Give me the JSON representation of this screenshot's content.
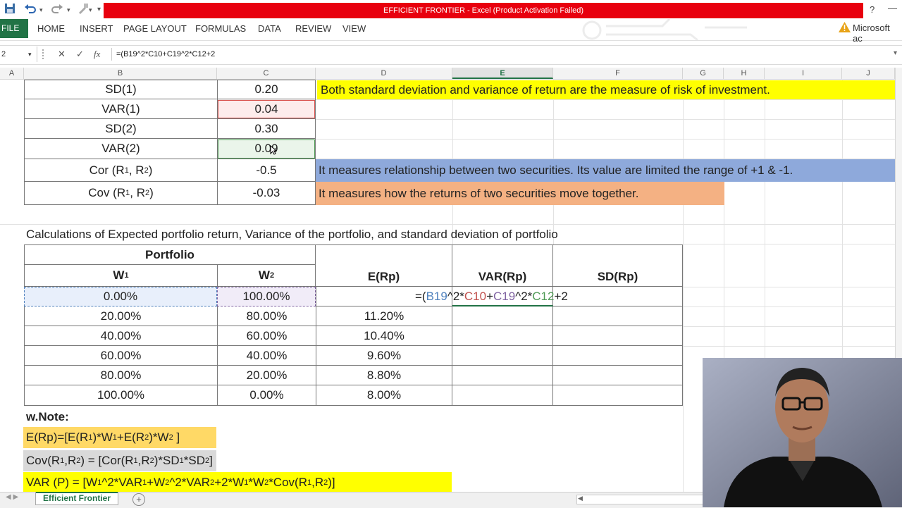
{
  "window": {
    "title": "EFFICIENT FRONTIER -  Excel (Product Activation Failed)",
    "help": "?",
    "minimize": "—",
    "warning": "Microsoft ac"
  },
  "ribbon": {
    "file": "FILE",
    "tabs": [
      "HOME",
      "INSERT",
      "PAGE LAYOUT",
      "FORMULAS",
      "DATA",
      "REVIEW",
      "VIEW"
    ]
  },
  "formula_bar": {
    "name_box": "2",
    "cancel": "✕",
    "enter": "✓",
    "fx": "fx",
    "formula": "=(B19^2*C10+C19^2*C12+2"
  },
  "columns": [
    "A",
    "B",
    "C",
    "D",
    "E",
    "F",
    "G",
    "H",
    "I",
    "J"
  ],
  "stats": {
    "sd1_label": "SD(1)",
    "sd1_value": "0.20",
    "var1_label": "VAR(1)",
    "var1_value": "0.04",
    "sd2_label": "SD(2)",
    "sd2_value": "0.30",
    "var2_label": "VAR(2)",
    "var2_value": "0.09",
    "cor_label": "Cor (R",
    "cor_value": "-0.5",
    "cov_label": "Cov (R",
    "cov_value": "-0.03",
    "sub1": "1",
    "sub2": "2",
    "comma": ", R",
    "close": ")"
  },
  "notes_side": {
    "risk": "Both standard deviation and variance of return are the measure of risk of investment.",
    "cor": "It measures relationship between two securities. Its value are limited the range of +1 & -1.",
    "cov": "It measures how the returns of two securities move together."
  },
  "calc_heading": "Calculations of Expected portfolio return, Variance of the portfolio, and standard deviation of portfolio",
  "table": {
    "portfolio": "Portfolio",
    "w": "W",
    "w1_sub": "1",
    "w2_sub": "2",
    "erp": "E(Rp)",
    "varrp": "VAR(Rp)",
    "sdrp": "SD(Rp)",
    "rows": [
      {
        "w1": "0.00%",
        "w2": "100.00%",
        "erp": ""
      },
      {
        "w1": "20.00%",
        "w2": "80.00%",
        "erp": "11.20%"
      },
      {
        "w1": "40.00%",
        "w2": "60.00%",
        "erp": "10.40%"
      },
      {
        "w1": "60.00%",
        "w2": "40.00%",
        "erp": "9.60%"
      },
      {
        "w1": "80.00%",
        "w2": "20.00%",
        "erp": "8.80%"
      },
      {
        "w1": "100.00%",
        "w2": "0.00%",
        "erp": "8.00%"
      }
    ],
    "edit_formula": {
      "p1": "=(",
      "r1": "B19",
      "p2": "^2*",
      "r2": "C10",
      "p3": "+",
      "r3": "C19",
      "p4": "^2*",
      "r4": "C12",
      "p5": "+2"
    }
  },
  "note_block": {
    "title": "w.Note:",
    "erp_formula": "E(Rp)=[E(R",
    "cov_formula": "Cov(R",
    "var_formula": "VAR (P) = [W"
  },
  "sheet_tab": "Efficient Frontier",
  "add_sheet": "+",
  "colors": {
    "excel_green": "#217346",
    "title_red": "#e8000e",
    "yellow": "#ffff00",
    "blue_band": "#8ea9db",
    "orange_band": "#f4b183",
    "gold": "#ffd966",
    "ref_blue": "#4f81bd",
    "ref_red": "#c0504d",
    "ref_purple": "#8064a2",
    "ref_green": "#4e9a54"
  }
}
